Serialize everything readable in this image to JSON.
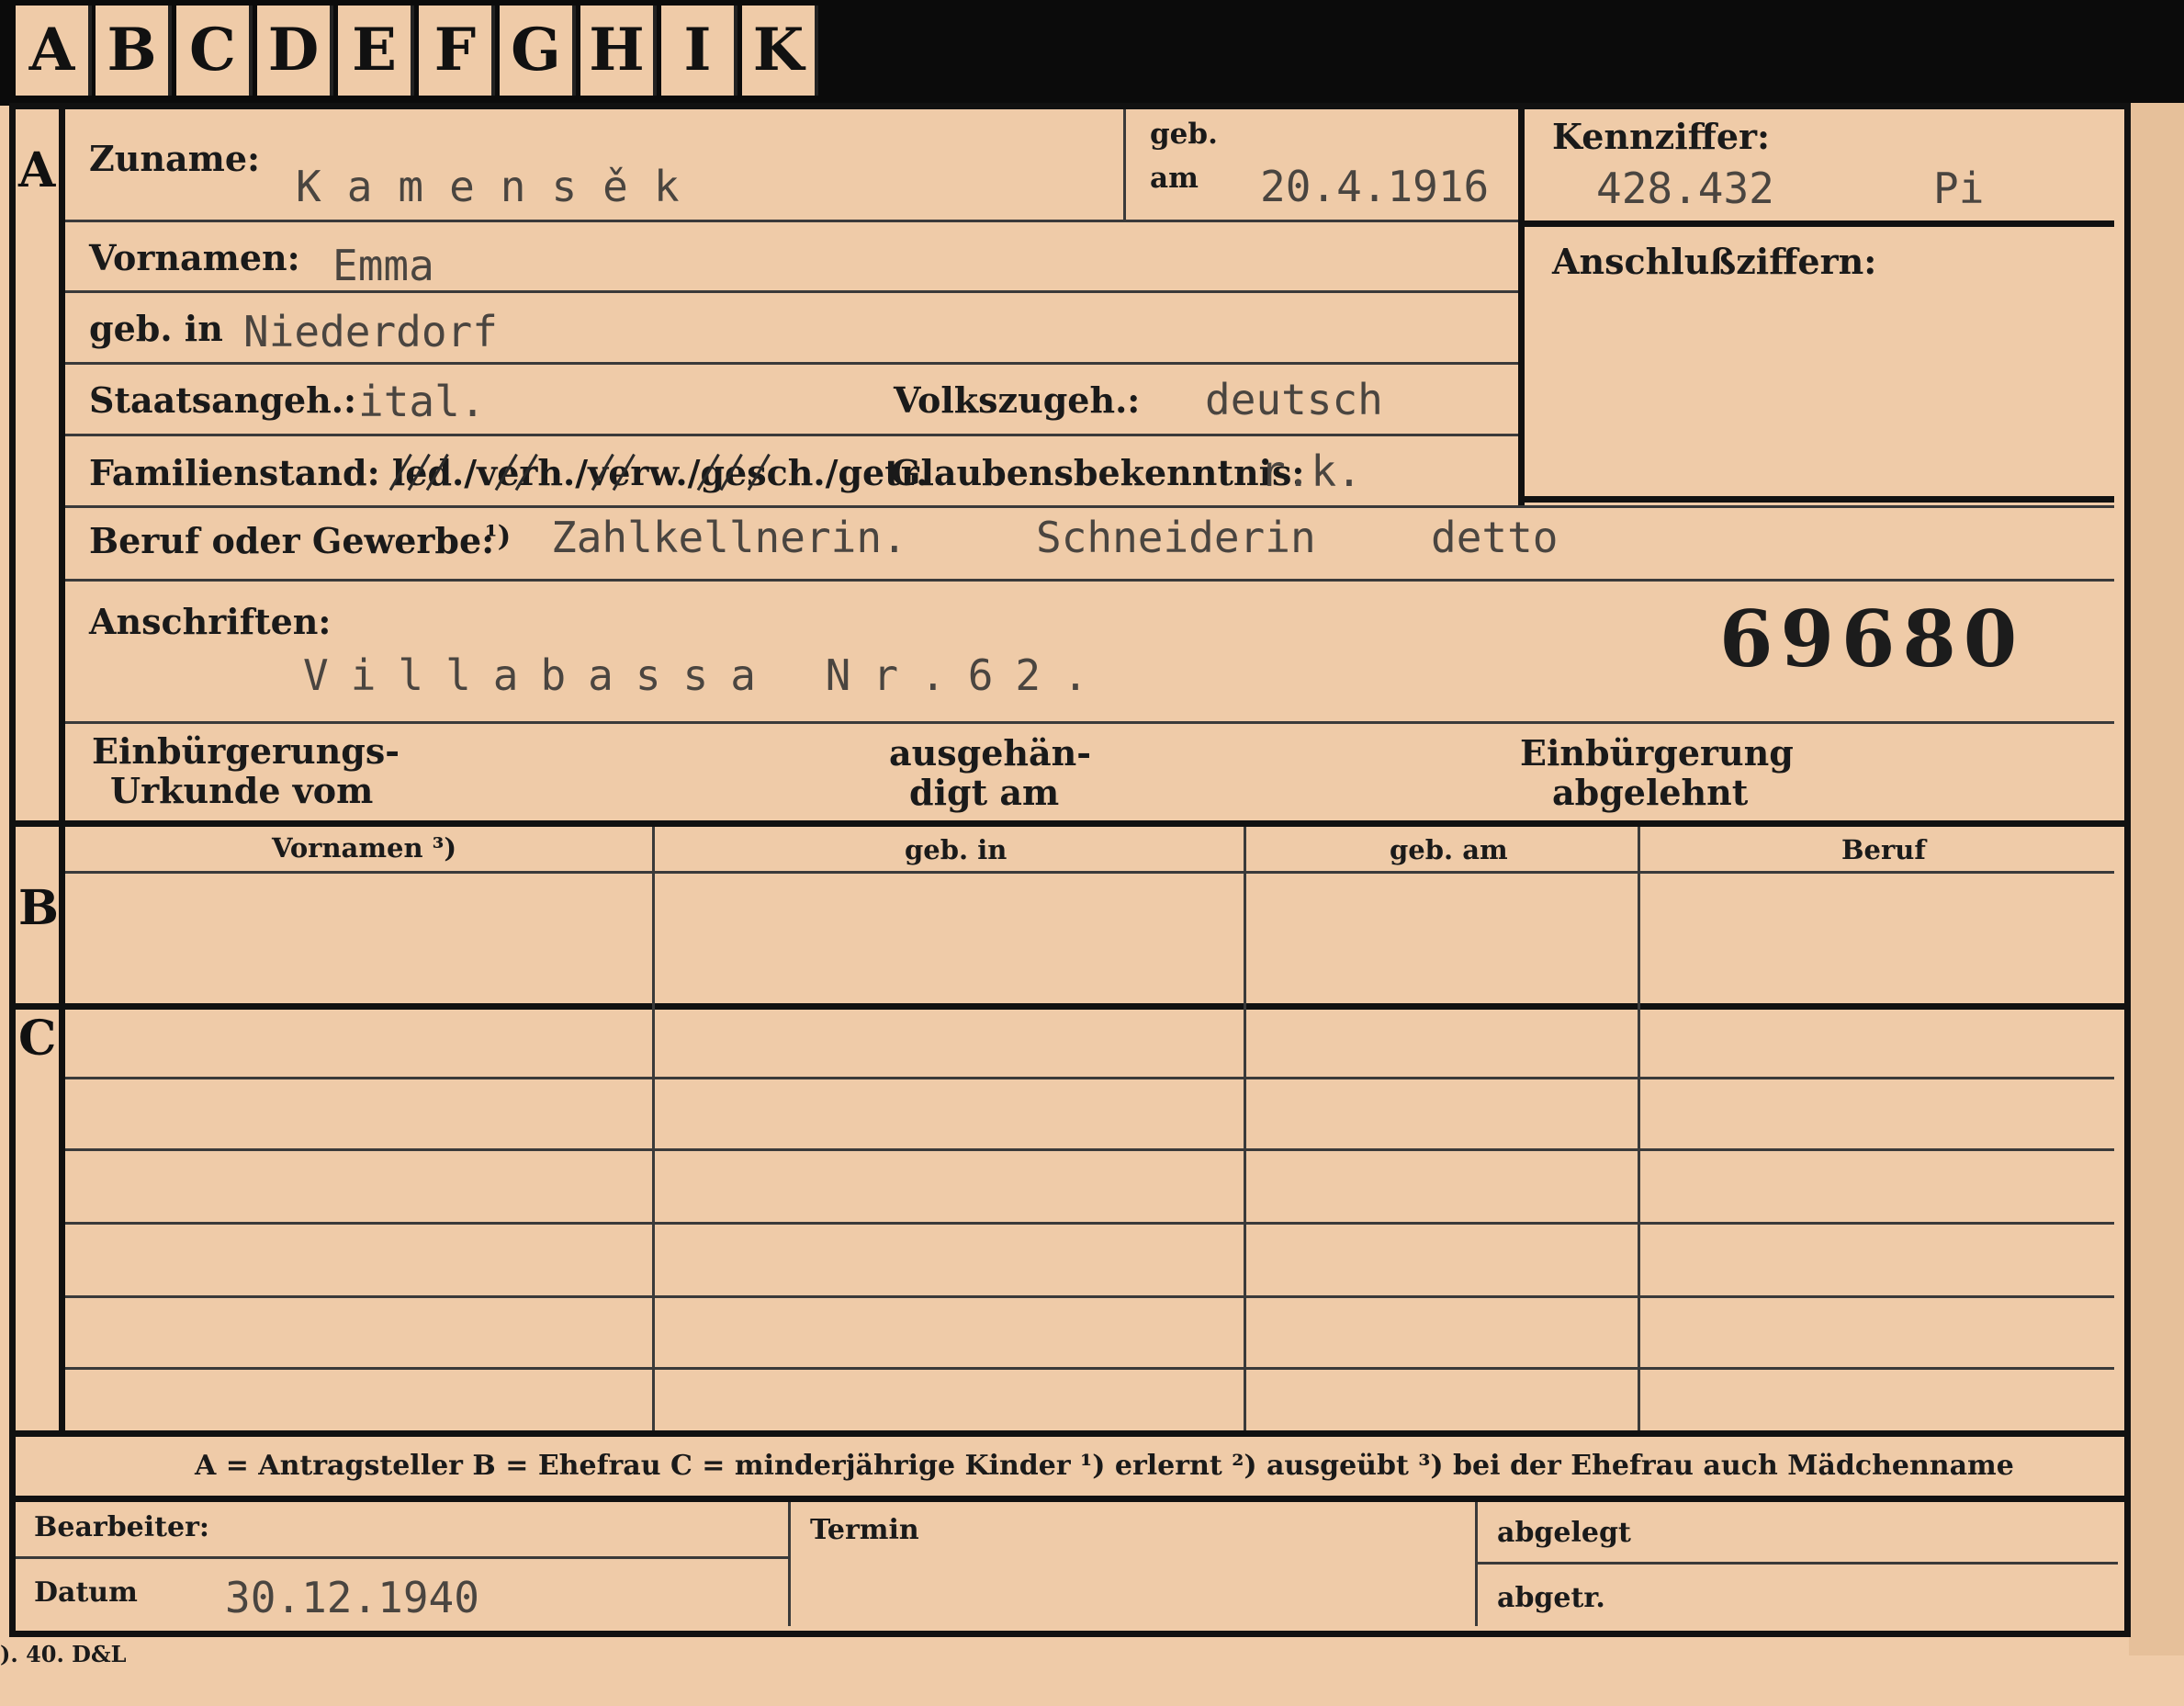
{
  "tabs": [
    "A",
    "B",
    "C",
    "D",
    "E",
    "F",
    "G",
    "H",
    "I",
    "K"
  ],
  "sections": {
    "a": "A",
    "b": "B",
    "c": "C"
  },
  "labels": {
    "zuname": "Zuname:",
    "geb": "geb.",
    "am": "am",
    "kennziffer": "Kennziffer:",
    "anschluss": "Anschlußziffern:",
    "vornamen": "Vornamen:",
    "geb_in": "geb. in",
    "staatsangeh": "Staatsangeh.:",
    "volkszugeh": "Volkszugeh.:",
    "familienstand": "Familienstand: led./verh./verw./gesch./getr.",
    "glaubens": "Glaubensbekenntnis:",
    "beruf": "Beruf oder Gewerbe:",
    "beruf_sup": "¹)",
    "anschriften": "Anschriften:",
    "einb_urk_1": "Einbürgerungs-",
    "einb_urk_2": "Urkunde vom",
    "ausgeh_1": "ausgehän-",
    "ausgeh_2": "digt am",
    "einb_abg_1": "Einbürgerung",
    "einb_abg_2": "abgelehnt"
  },
  "values": {
    "zuname": "Kamensěk",
    "geb_am": "20.4.1916",
    "kennziffer": "428.432",
    "kennziffer_suffix": "Pi",
    "vornamen": "Emma",
    "geb_in": "Niederdorf",
    "staatsangeh": "ital.",
    "volkszugeh": "deutsch",
    "glaubens": "r.k.",
    "beruf_1": "Zahlkellnerin.",
    "beruf_2": "Schneiderin",
    "beruf_3": "detto",
    "anschrift": "Villabassa Nr.62.",
    "stamp_number": "69680"
  },
  "table": {
    "headers": [
      "Vornamen ³)",
      "geb. in",
      "geb. am",
      "Beruf"
    ]
  },
  "legend": "A = Antragsteller   B = Ehefrau   C = minderjährige Kinder   ¹) erlernt   ²) ausgeübt   ³) bei der Ehefrau auch Mädchenname",
  "footer": {
    "bearbeiter": "Bearbeiter:",
    "datum": "Datum",
    "datum_value": "30.12.1940",
    "termin": "Termin",
    "abgelegt": "abgelegt",
    "abgetr": "abgetr.",
    "print_mark": "). 40. D&L"
  }
}
